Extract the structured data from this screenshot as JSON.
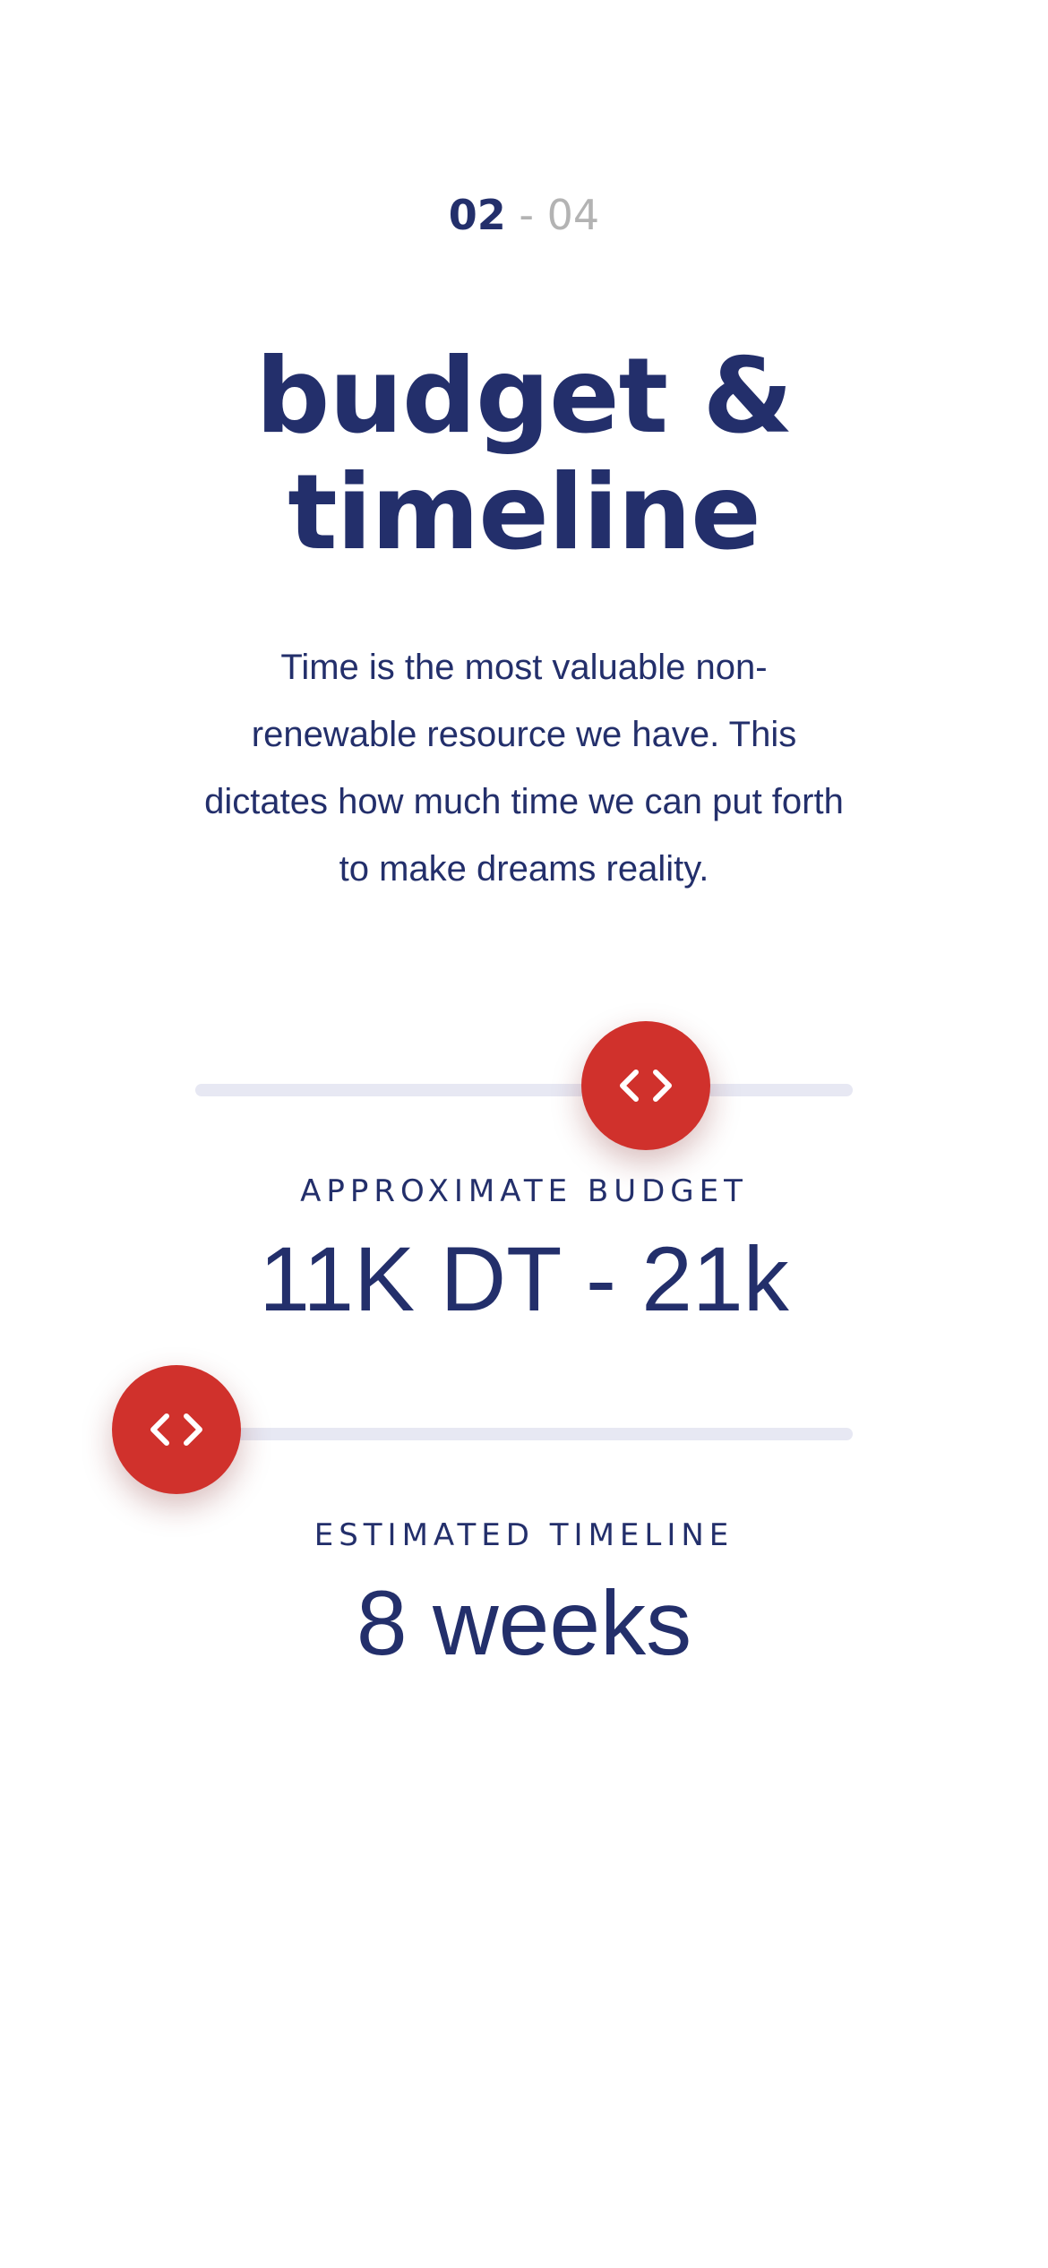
{
  "step": {
    "current": "02",
    "separator": "-",
    "total": "04"
  },
  "title": {
    "line1": "budget &",
    "line2": "timeline"
  },
  "description": "Time is the most valuable non-renewable resource we have. This dictates how much time we can put forth to make dreams reality.",
  "budget": {
    "label": "APPROXIMATE BUDGET",
    "value": "11K DT - 21k",
    "slider_position": 0.68
  },
  "timeline": {
    "label": "ESTIMATED TIMELINE",
    "value": "8 weeks",
    "slider_position": 0.0
  },
  "colors": {
    "primary": "#232f6b",
    "accent": "#d0312c",
    "track": "#e7e8f3",
    "muted": "#b3b3b3"
  },
  "icons": {
    "slider_handle": "chevron-left-right-icon"
  }
}
